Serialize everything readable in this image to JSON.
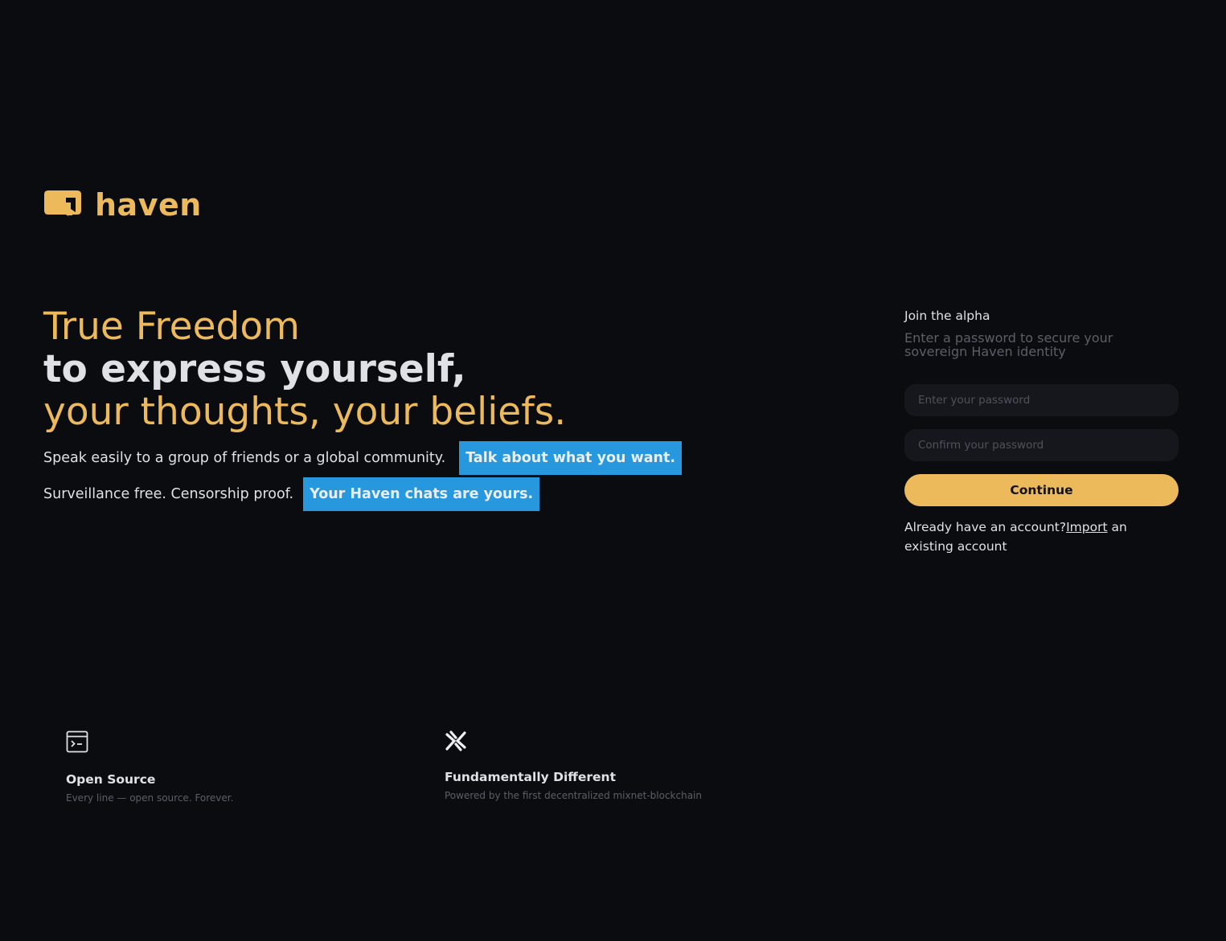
{
  "brand": {
    "name": "haven",
    "logo_icon": "haven-logo-icon",
    "accent_color": "#ecb95b"
  },
  "hero": {
    "line1": "True Freedom",
    "line2": "to express yourself,",
    "line3": "your thoughts, your beliefs."
  },
  "taglines": [
    {
      "text": "Speak easily to a group of friends or a global community.",
      "highlight": "Talk about what you want."
    },
    {
      "text": "Surveillance free. Censorship proof.",
      "highlight": "Your Haven chats are yours."
    }
  ],
  "highlight_color": "#2798dd",
  "signup": {
    "title": "Join the alpha",
    "subtitle": "Enter a password to secure your sovereign Haven identity",
    "password_placeholder": "Enter your password",
    "confirm_placeholder": "Confirm your password",
    "continue_label": "Continue",
    "import_prefix": "Already have an account?",
    "import_link": "Import",
    "import_suffix": " an existing account"
  },
  "features": [
    {
      "icon": "terminal-icon",
      "title": "Open Source",
      "description": "Every line — open source. Forever."
    },
    {
      "icon": "mixnet-icon",
      "title": "Fundamentally Different",
      "description": "Powered by the first decentralized mixnet-blockchain"
    }
  ]
}
